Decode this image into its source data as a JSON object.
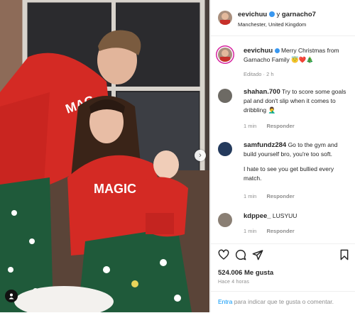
{
  "post": {
    "author": "eevichuu",
    "coauthor_connector": "y",
    "coauthor": "garnacho7",
    "location": "Manchester, United Kingdom",
    "caption_user": "eevichuu",
    "caption_text": "Merry Christmas from Garnacho Family",
    "caption_emojis": "😇❤️🎄",
    "caption_meta": "Editado · 2 h",
    "photo_text": "MAGIC"
  },
  "comments": [
    {
      "user": "shahan.700",
      "text": "Try to score some goals pal and don't slip when it comes to dribbling 🤦‍♂️",
      "time": "1 min",
      "reply": "Responder"
    },
    {
      "user": "samfundz284",
      "text": "Go to the gym and build yourself bro, you're too soft.",
      "text2": "I hate to see you get bullied every match.",
      "time": "1 min",
      "reply": "Responder"
    },
    {
      "user": "kdppee_",
      "text": "LUSYUU",
      "time": "1 min",
      "reply": "Responder"
    }
  ],
  "stats": {
    "likes": "524.006 Me gusta",
    "date": "Hace 4 horas"
  },
  "login": {
    "link": "Entra",
    "rest": " para indicar que te gusta o comentar."
  },
  "icons": [
    "heart-icon",
    "comment-icon",
    "share-icon",
    "bookmark-icon",
    "chevron-right-icon",
    "user-tag-icon",
    "verified-badge-icon"
  ],
  "colors": {
    "verified": "#3897f0",
    "link": "#0095f6",
    "sweater": "#d42a24",
    "muted": "#8e8e8e"
  }
}
